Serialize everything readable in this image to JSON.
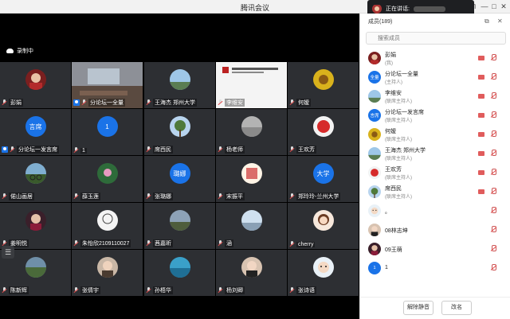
{
  "window": {
    "title": "腾讯会议"
  },
  "recording": {
    "label": "录制中"
  },
  "speaking": {
    "label": "正在讲话:"
  },
  "colors": {
    "accent": "#1a73e8",
    "muted_red": "#e24b4b"
  },
  "tiles": [
    {
      "name": "彭娟",
      "avatar": "photo-girl-red",
      "host": false
    },
    {
      "name": "分论坛一全量",
      "avatar": "meeting-room-screen",
      "host": true
    },
    {
      "name": "王海杰 郑州大学",
      "avatar": "photo-sky",
      "host": false
    },
    {
      "name": "李维安",
      "avatar": "slide-screen",
      "host": false
    },
    {
      "name": "何嫒",
      "avatar": "photo-yellow",
      "host": false
    },
    {
      "name": "",
      "avatar": "empty",
      "host": false
    },
    {
      "name": "",
      "avatar": "empty",
      "host": false
    },
    {
      "name": "",
      "avatar": "empty",
      "host": false
    },
    {
      "name": "",
      "avatar": "empty",
      "host": false
    },
    {
      "name": "",
      "avatar": "empty",
      "host": false
    },
    {
      "name": "分论坛一发言席",
      "avatar_text": "言席",
      "host": true
    },
    {
      "name": "1",
      "avatar_text": "1",
      "host": false
    },
    {
      "name": "席西民",
      "avatar": "photo-tree",
      "host": false
    },
    {
      "name": "杨老师",
      "avatar": "photo-gray",
      "host": false
    },
    {
      "name": "王欢芳",
      "avatar": "photo-red-flower",
      "host": false
    },
    {
      "name": "偌山画居",
      "avatar": "photo-bike",
      "host": false
    },
    {
      "name": "薛玉莲",
      "avatar": "photo-lotus",
      "host": false
    },
    {
      "name": "张璐娜",
      "avatar_text": "璐娜",
      "host": false
    },
    {
      "name": "宋振平",
      "avatar": "photo-calligraphy",
      "host": false
    },
    {
      "name": "郑玲玲-兰州大学",
      "avatar_text": "大学",
      "host": false
    },
    {
      "name": "姜明悦",
      "avatar": "photo-girl-dark",
      "host": false
    },
    {
      "name": "朱怡欣2109110027",
      "avatar": "photo-sketch",
      "host": false
    },
    {
      "name": "茜嘉昕",
      "avatar": "photo-scene",
      "host": false
    },
    {
      "name": "涵",
      "avatar": "photo-winter",
      "host": false
    },
    {
      "name": "cherry",
      "avatar": "photo-cartoon-girl",
      "host": false
    },
    {
      "name": "陈新辉",
      "avatar": "photo-landscape",
      "host": false
    },
    {
      "name": "张倩宇",
      "avatar": "photo-girl-light",
      "host": false
    },
    {
      "name": "孙梧华",
      "avatar": "photo-ocean",
      "host": false
    },
    {
      "name": "杨刘卿",
      "avatar": "photo-portrait",
      "host": false
    },
    {
      "name": "张诗语",
      "avatar": "photo-cartoon",
      "host": false
    }
  ],
  "panel": {
    "title": "成员(189)",
    "search_placeholder": "搜索成员",
    "members": [
      {
        "name": "彭娟",
        "role": "(我)",
        "avatar": "photo-girl-red"
      },
      {
        "name": "分论坛一全量",
        "role": "(主持人)",
        "avatar_text": "全量"
      },
      {
        "name": "李维安",
        "role": "(联席主持人)",
        "avatar": "photo-sky"
      },
      {
        "name": "分论坛一发言席",
        "role": "(联席主持人)",
        "avatar_text": "言席"
      },
      {
        "name": "何嫒",
        "role": "(联席主持人)",
        "avatar": "photo-yellow"
      },
      {
        "name": "王海杰 郑州大学",
        "role": "(联席主持人)",
        "avatar": "photo-sky"
      },
      {
        "name": "王欢芳",
        "role": "(联席主持人)",
        "avatar": "photo-red-flower"
      },
      {
        "name": "席西民",
        "role": "(联席主持人)",
        "avatar": "photo-tree"
      },
      {
        "name": "。",
        "role": "",
        "avatar": "photo-cartoon"
      },
      {
        "name": "08林志坤",
        "role": "",
        "avatar": "photo-portrait"
      },
      {
        "name": "09王萌",
        "role": "",
        "avatar": "photo-girl-dark"
      },
      {
        "name": "1",
        "role": "",
        "avatar_text": "1"
      }
    ],
    "mute_all_label": "解除静音",
    "rename_label": "改名"
  }
}
